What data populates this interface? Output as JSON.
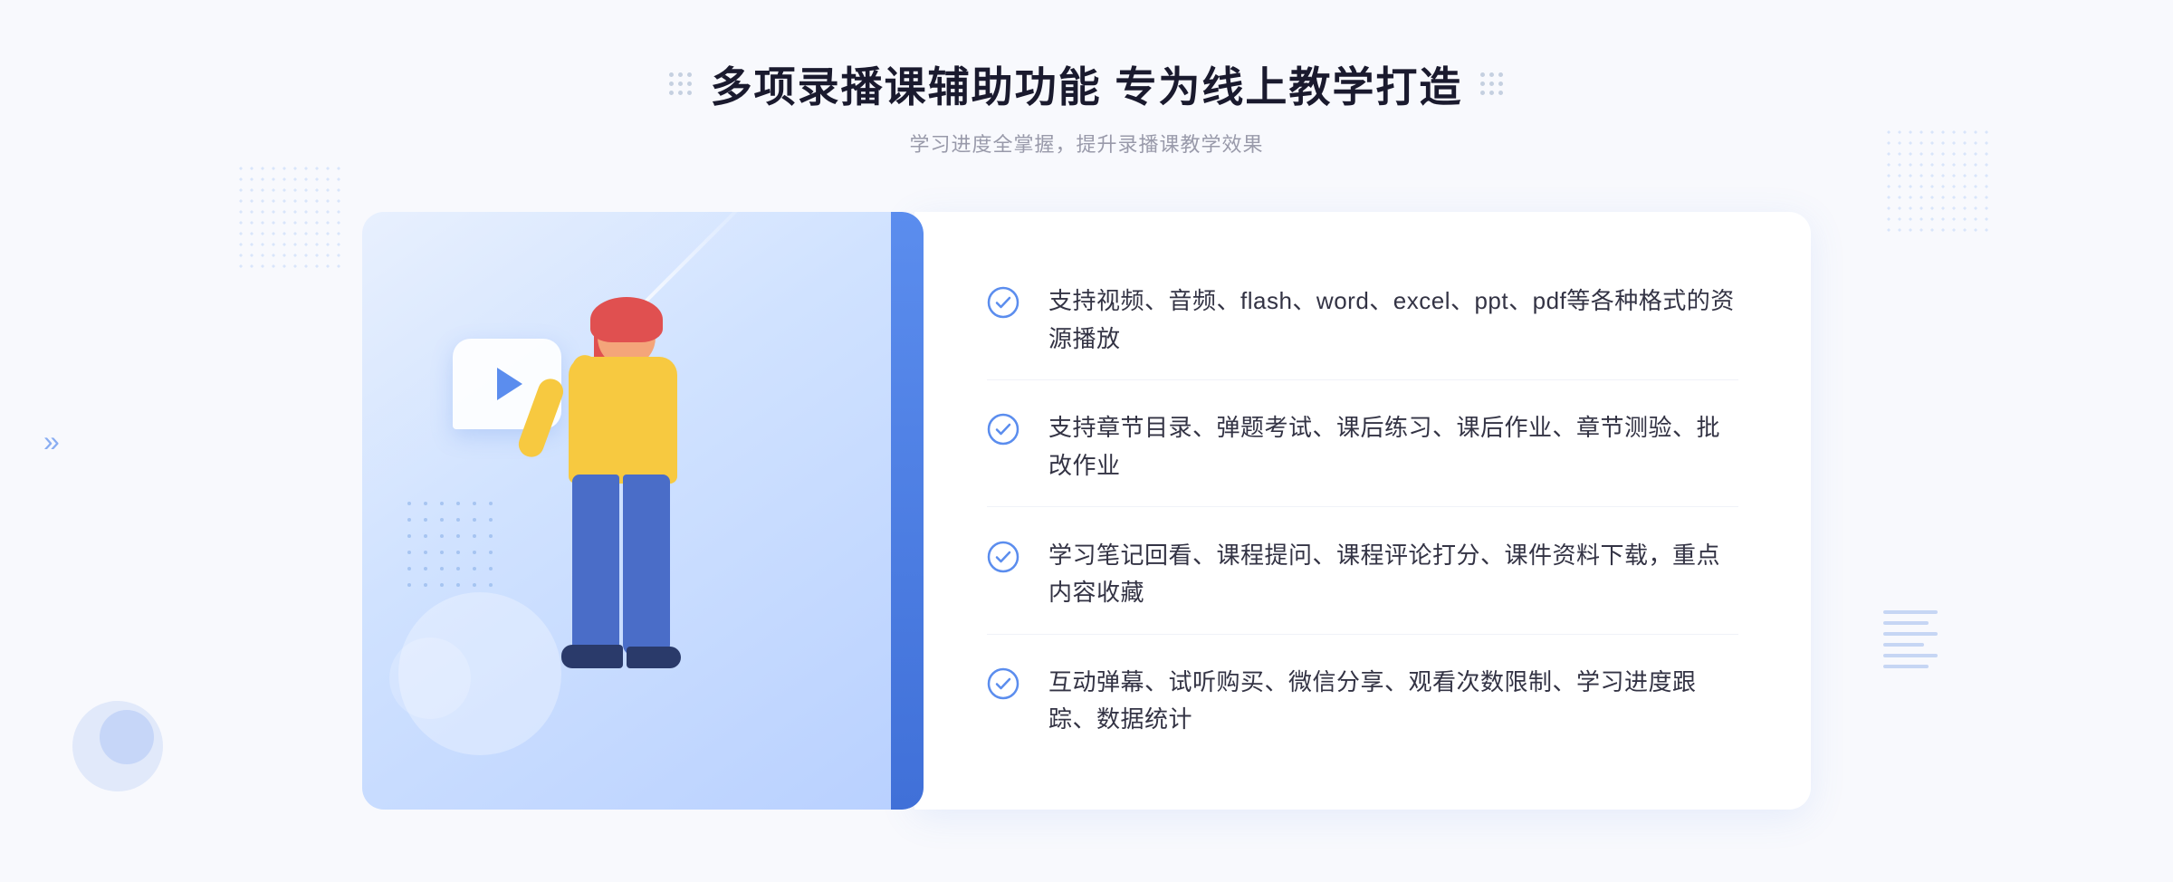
{
  "page": {
    "background_color": "#f5f7fc"
  },
  "header": {
    "title": "多项录播课辅助功能 专为线上教学打造",
    "subtitle": "学习进度全掌握，提升录播课教学效果",
    "decorator_left": "grid",
    "decorator_right": "grid"
  },
  "features": [
    {
      "id": 1,
      "text": "支持视频、音频、flash、word、excel、ppt、pdf等各种格式的资源播放"
    },
    {
      "id": 2,
      "text": "支持章节目录、弹题考试、课后练习、课后作业、章节测验、批改作业"
    },
    {
      "id": 3,
      "text": "学习笔记回看、课程提问、课程评论打分、课件资料下载，重点内容收藏"
    },
    {
      "id": 4,
      "text": "互动弹幕、试听购买、微信分享、观看次数限制、学习进度跟踪、数据统计"
    }
  ],
  "check_icon": {
    "color": "#5b8dee",
    "symbol": "✓"
  },
  "decorations": {
    "left_chevrons": "»",
    "accent_color": "#5b8dee",
    "dot_color": "#c5d0e0"
  }
}
